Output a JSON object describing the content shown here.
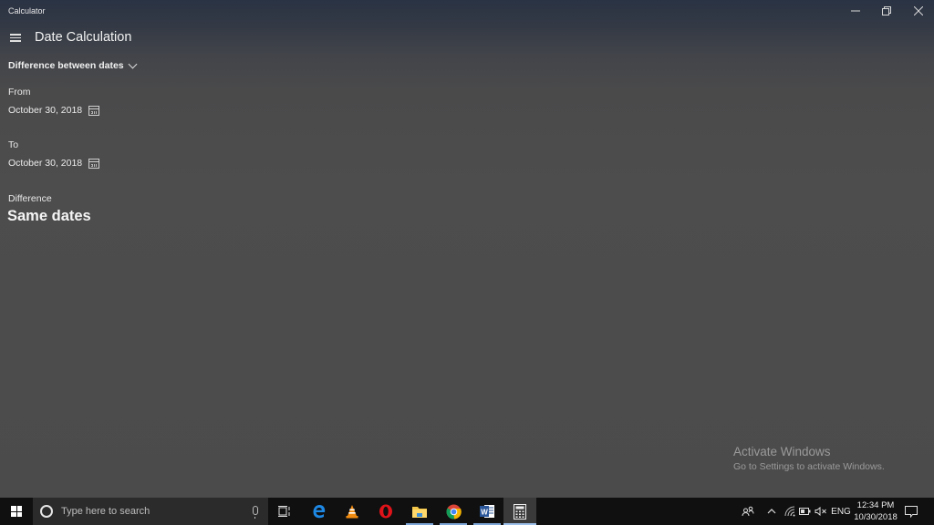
{
  "window": {
    "title": "Calculator",
    "controls": {
      "minimize": "—",
      "restore": "❐",
      "close": "✕"
    }
  },
  "header": {
    "menu_icon": "hamburger-icon",
    "title": "Date Calculation"
  },
  "mode": {
    "selected": "Difference between dates",
    "icon": "chevron-down-icon"
  },
  "from": {
    "label": "From",
    "value": "October 30, 2018",
    "icon": "calendar-icon"
  },
  "to": {
    "label": "To",
    "value": "October 30, 2018",
    "icon": "calendar-icon"
  },
  "difference": {
    "label": "Difference",
    "value": "Same dates"
  },
  "watermark": {
    "title": "Activate Windows",
    "subtitle": "Go to Settings to activate Windows."
  },
  "taskbar": {
    "search_placeholder": "Type here to search",
    "apps": [
      {
        "name": "task-view",
        "icon": "task-view-icon"
      },
      {
        "name": "edge",
        "icon": "edge-icon"
      },
      {
        "name": "vlc",
        "icon": "vlc-icon"
      },
      {
        "name": "opera",
        "icon": "opera-icon"
      },
      {
        "name": "file-explorer",
        "icon": "folder-icon",
        "running": true
      },
      {
        "name": "chrome",
        "icon": "chrome-icon",
        "running": true
      },
      {
        "name": "word",
        "icon": "word-icon",
        "running": true
      },
      {
        "name": "calculator",
        "icon": "calculator-icon",
        "active": true
      }
    ],
    "tray": {
      "language": "ENG",
      "time": "12:34 PM",
      "date": "10/30/2018"
    },
    "colors": {
      "running_indicator": "#7ea7d8",
      "background": "#101010"
    }
  }
}
